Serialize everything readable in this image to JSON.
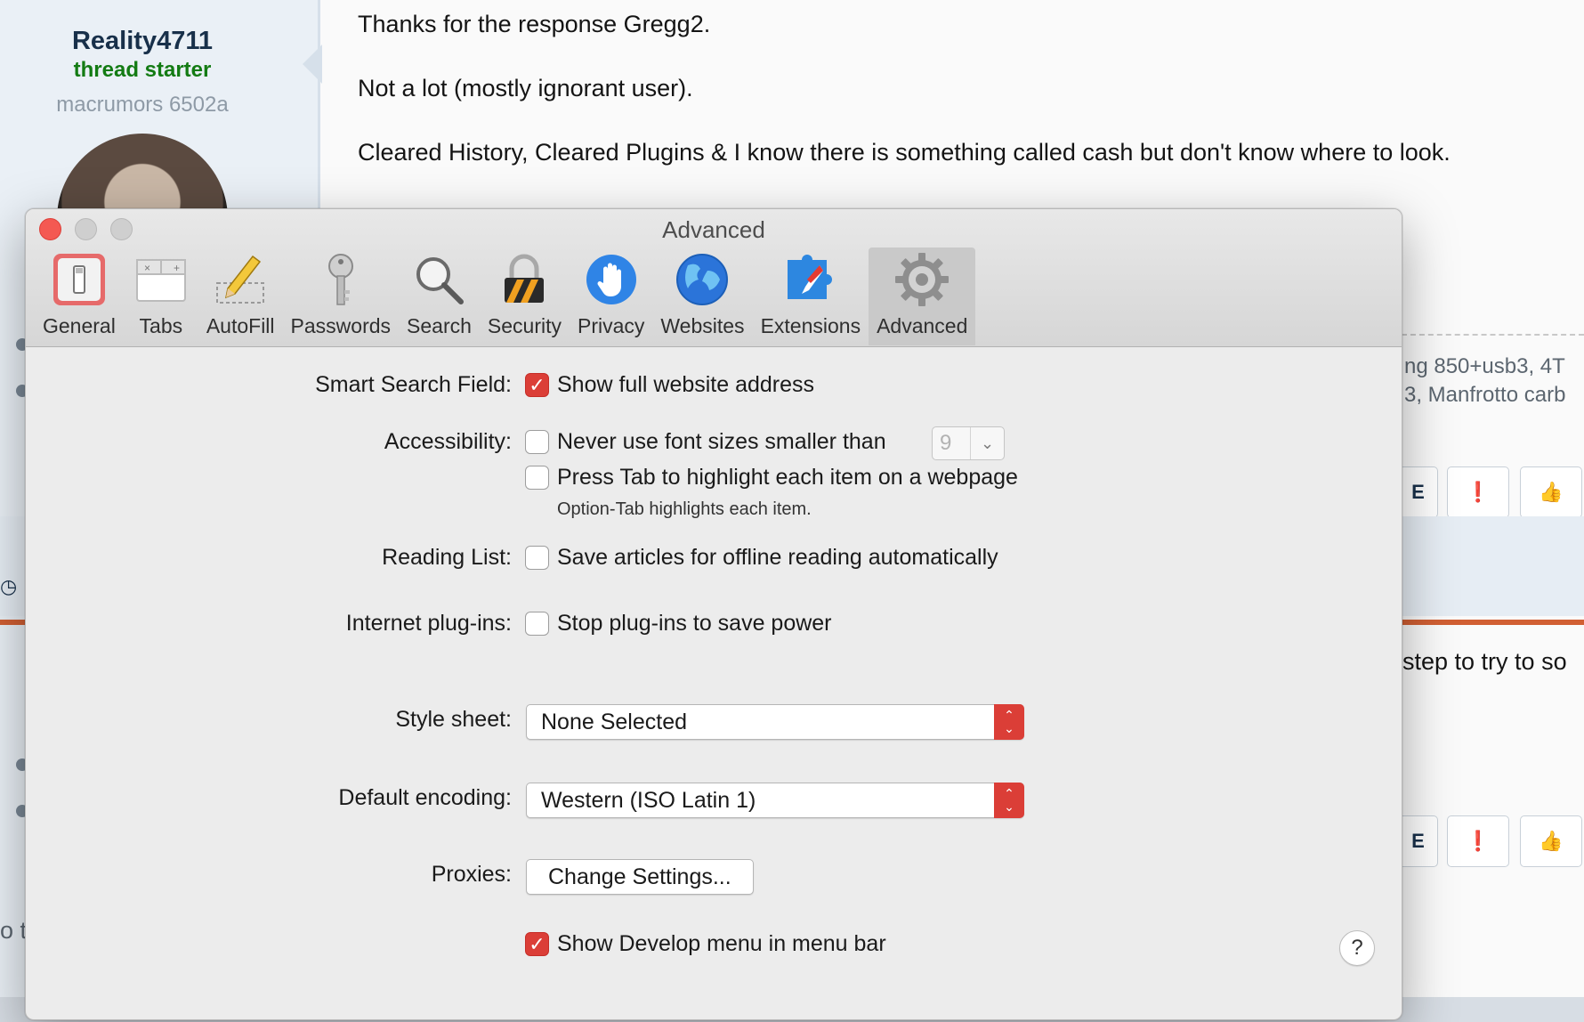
{
  "forum": {
    "username": "Reality4711",
    "user_tag": "thread starter",
    "user_rank": "macrumors 6502a",
    "message_lines": [
      "Thanks for the response Gregg2.",
      "Not a lot (mostly ignorant user).",
      "Cleared History, Cleared Plugins & I know there is something called cash but don't know where to look."
    ],
    "signature_lines": [
      "ng 850+usb3, 4T",
      "3, Manfrotto carb"
    ],
    "reply_snippet": "step to try to so",
    "buttons": {
      "partial_label": "E",
      "report_glyph": "❗",
      "like_glyph": "👍"
    },
    "partial_left_text": "o t"
  },
  "window": {
    "title": "Advanced",
    "toolbar": [
      {
        "label": "General",
        "icon": "general-switch-icon"
      },
      {
        "label": "Tabs",
        "icon": "tabs-icon"
      },
      {
        "label": "AutoFill",
        "icon": "autofill-pencil-icon"
      },
      {
        "label": "Passwords",
        "icon": "key-icon"
      },
      {
        "label": "Search",
        "icon": "magnifier-icon"
      },
      {
        "label": "Security",
        "icon": "padlock-icon"
      },
      {
        "label": "Privacy",
        "icon": "hand-icon"
      },
      {
        "label": "Websites",
        "icon": "globe-icon"
      },
      {
        "label": "Extensions",
        "icon": "compass-puzzle-icon"
      },
      {
        "label": "Advanced",
        "icon": "gear-icon",
        "active": true
      }
    ],
    "settings": {
      "smart_search": {
        "label": "Smart Search Field:",
        "option": "Show full website address",
        "checked": true
      },
      "accessibility": {
        "label": "Accessibility:",
        "font_option": "Never use font sizes smaller than",
        "font_checked": false,
        "font_size": "9",
        "tab_option": "Press Tab to highlight each item on a webpage",
        "tab_checked": false,
        "tab_hint": "Option-Tab highlights each item."
      },
      "reading_list": {
        "label": "Reading List:",
        "option": "Save articles for offline reading automatically",
        "checked": false
      },
      "plugins": {
        "label": "Internet plug-ins:",
        "option": "Stop plug-ins to save power",
        "checked": false
      },
      "style_sheet": {
        "label": "Style sheet:",
        "value": "None Selected"
      },
      "encoding": {
        "label": "Default encoding:",
        "value": "Western (ISO Latin 1)"
      },
      "proxies": {
        "label": "Proxies:",
        "button": "Change Settings..."
      },
      "develop": {
        "option": "Show Develop menu in menu bar",
        "checked": true
      },
      "help": "?"
    },
    "colors": {
      "accent": "#db3e37",
      "close": "#f45952"
    }
  }
}
